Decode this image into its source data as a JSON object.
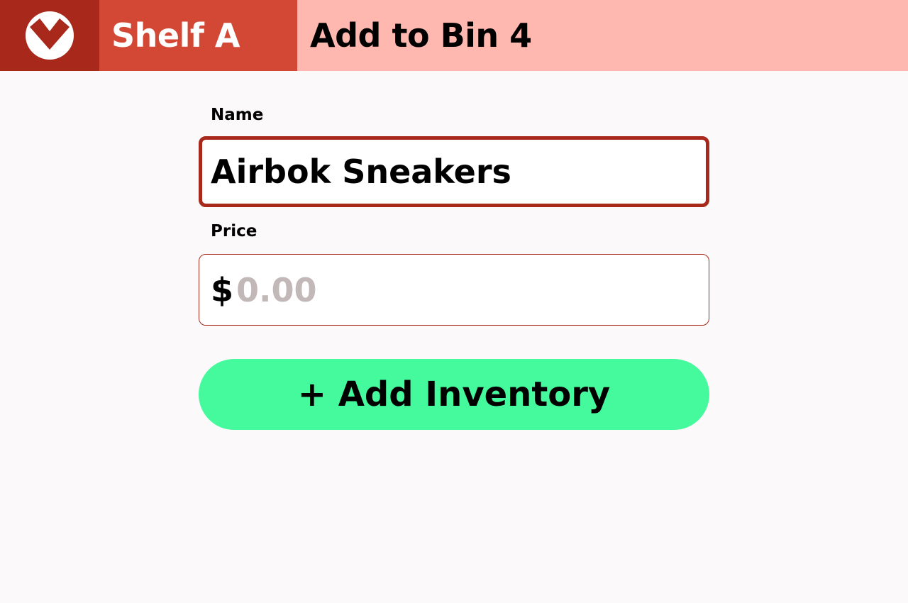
{
  "header": {
    "logo_icon": "checkmark-badge-icon",
    "shelf_title": "Shelf A",
    "page_title": "Add to Bin 4",
    "colors": {
      "logo_bg": "#a8291b",
      "shelf_bg": "#d34735",
      "title_bg": "#ffb8b0"
    }
  },
  "form": {
    "name_label": "Name",
    "name_value": "Airbok Sneakers",
    "price_label": "Price",
    "price_currency": "$",
    "price_placeholder": "0.00",
    "price_value": "",
    "submit_label": "+ Add Inventory",
    "submit_color": "#44fa9d",
    "accent_color": "#a8291b"
  }
}
